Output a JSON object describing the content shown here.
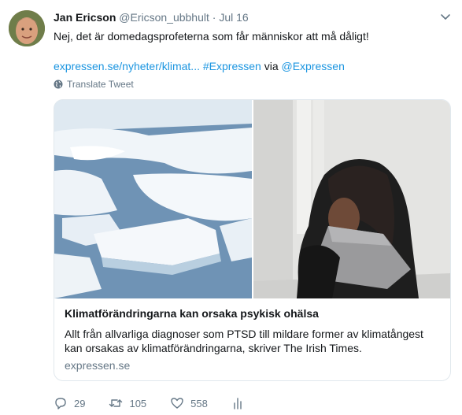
{
  "tweet": {
    "author_name": "Jan Ericson",
    "author_handle": "@Ericson_ubbhult",
    "separator": "·",
    "timestamp": "Jul 16",
    "text": "Nej, det är domedagsprofeterna som får människor att må dåligt!",
    "link_url": "expressen.se/nyheter/klimat...",
    "hashtag": "#Expressen",
    "via_word": "via",
    "via_handle": "@Expressen",
    "translate_label": "Translate Tweet"
  },
  "card": {
    "title": "Klimatförändringarna kan orsaka psykisk ohälsa",
    "description": "Allt från allvarliga diagnoser som PTSD till mildare former av klimatångest kan orsakas av klimatförändringarna, skriver The Irish Times.",
    "domain": "expressen.se"
  },
  "actions": {
    "reply_count": "29",
    "retweet_count": "105",
    "like_count": "558"
  },
  "icons": {
    "more": "chevron-down-icon",
    "translate": "globe-icon",
    "reply": "reply-icon",
    "retweet": "retweet-icon",
    "like": "heart-icon",
    "analytics": "analytics-icon"
  },
  "colors": {
    "link": "#1b95e0",
    "muted": "#657786",
    "text": "#14171a",
    "border": "#e1e8ed"
  }
}
